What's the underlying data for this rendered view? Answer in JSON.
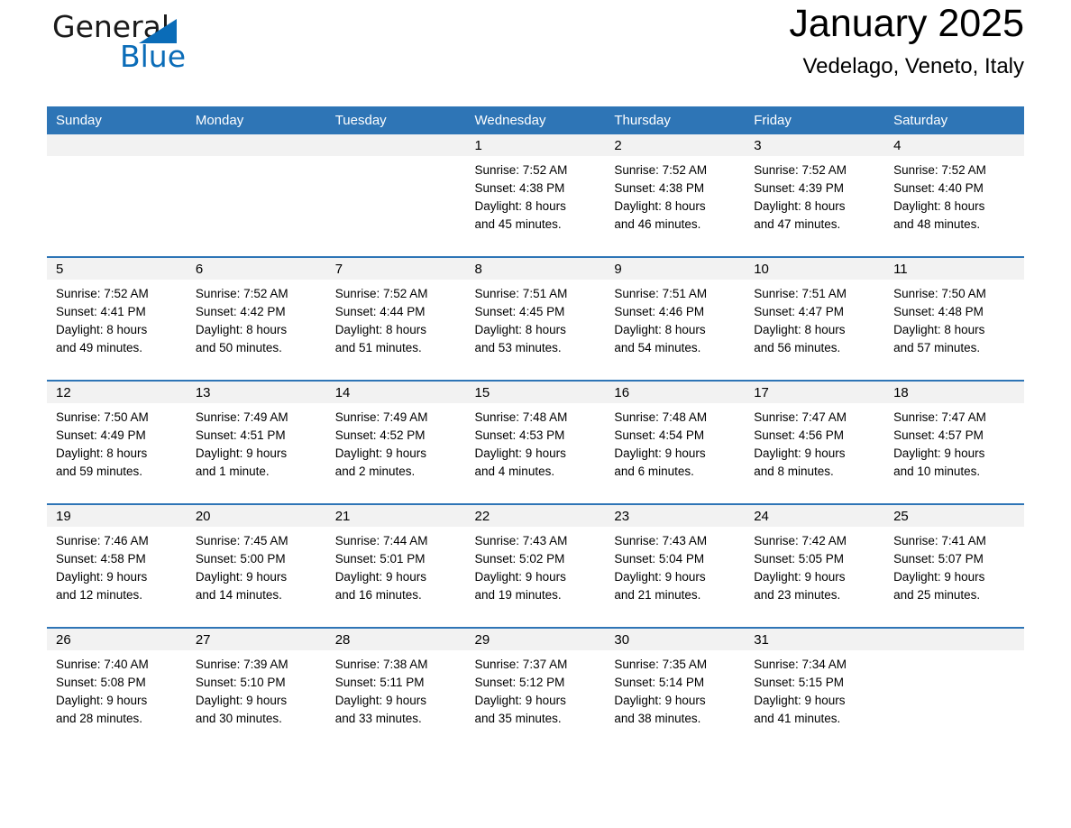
{
  "brand": {
    "name_part1": "General",
    "name_part2": "Blue",
    "triangle_color": "#0a6cb8"
  },
  "header": {
    "month_title": "January 2025",
    "location": "Vedelago, Veneto, Italy",
    "header_bg": "#2e75b6",
    "daynum_bg": "#f2f2f2"
  },
  "weekday_headers": [
    "Sunday",
    "Monday",
    "Tuesday",
    "Wednesday",
    "Thursday",
    "Friday",
    "Saturday"
  ],
  "labels": {
    "sunrise_prefix": "Sunrise:",
    "sunset_prefix": "Sunset:",
    "daylight_prefix": "Daylight:"
  },
  "weeks": [
    [
      {
        "day": "",
        "empty": true
      },
      {
        "day": "",
        "empty": true
      },
      {
        "day": "",
        "empty": true
      },
      {
        "day": "1",
        "sunrise": "Sunrise: 7:52 AM",
        "sunset": "Sunset: 4:38 PM",
        "daylight_line1": "Daylight: 8 hours",
        "daylight_line2": "and 45 minutes."
      },
      {
        "day": "2",
        "sunrise": "Sunrise: 7:52 AM",
        "sunset": "Sunset: 4:38 PM",
        "daylight_line1": "Daylight: 8 hours",
        "daylight_line2": "and 46 minutes."
      },
      {
        "day": "3",
        "sunrise": "Sunrise: 7:52 AM",
        "sunset": "Sunset: 4:39 PM",
        "daylight_line1": "Daylight: 8 hours",
        "daylight_line2": "and 47 minutes."
      },
      {
        "day": "4",
        "sunrise": "Sunrise: 7:52 AM",
        "sunset": "Sunset: 4:40 PM",
        "daylight_line1": "Daylight: 8 hours",
        "daylight_line2": "and 48 minutes."
      }
    ],
    [
      {
        "day": "5",
        "sunrise": "Sunrise: 7:52 AM",
        "sunset": "Sunset: 4:41 PM",
        "daylight_line1": "Daylight: 8 hours",
        "daylight_line2": "and 49 minutes."
      },
      {
        "day": "6",
        "sunrise": "Sunrise: 7:52 AM",
        "sunset": "Sunset: 4:42 PM",
        "daylight_line1": "Daylight: 8 hours",
        "daylight_line2": "and 50 minutes."
      },
      {
        "day": "7",
        "sunrise": "Sunrise: 7:52 AM",
        "sunset": "Sunset: 4:44 PM",
        "daylight_line1": "Daylight: 8 hours",
        "daylight_line2": "and 51 minutes."
      },
      {
        "day": "8",
        "sunrise": "Sunrise: 7:51 AM",
        "sunset": "Sunset: 4:45 PM",
        "daylight_line1": "Daylight: 8 hours",
        "daylight_line2": "and 53 minutes."
      },
      {
        "day": "9",
        "sunrise": "Sunrise: 7:51 AM",
        "sunset": "Sunset: 4:46 PM",
        "daylight_line1": "Daylight: 8 hours",
        "daylight_line2": "and 54 minutes."
      },
      {
        "day": "10",
        "sunrise": "Sunrise: 7:51 AM",
        "sunset": "Sunset: 4:47 PM",
        "daylight_line1": "Daylight: 8 hours",
        "daylight_line2": "and 56 minutes."
      },
      {
        "day": "11",
        "sunrise": "Sunrise: 7:50 AM",
        "sunset": "Sunset: 4:48 PM",
        "daylight_line1": "Daylight: 8 hours",
        "daylight_line2": "and 57 minutes."
      }
    ],
    [
      {
        "day": "12",
        "sunrise": "Sunrise: 7:50 AM",
        "sunset": "Sunset: 4:49 PM",
        "daylight_line1": "Daylight: 8 hours",
        "daylight_line2": "and 59 minutes."
      },
      {
        "day": "13",
        "sunrise": "Sunrise: 7:49 AM",
        "sunset": "Sunset: 4:51 PM",
        "daylight_line1": "Daylight: 9 hours",
        "daylight_line2": "and 1 minute."
      },
      {
        "day": "14",
        "sunrise": "Sunrise: 7:49 AM",
        "sunset": "Sunset: 4:52 PM",
        "daylight_line1": "Daylight: 9 hours",
        "daylight_line2": "and 2 minutes."
      },
      {
        "day": "15",
        "sunrise": "Sunrise: 7:48 AM",
        "sunset": "Sunset: 4:53 PM",
        "daylight_line1": "Daylight: 9 hours",
        "daylight_line2": "and 4 minutes."
      },
      {
        "day": "16",
        "sunrise": "Sunrise: 7:48 AM",
        "sunset": "Sunset: 4:54 PM",
        "daylight_line1": "Daylight: 9 hours",
        "daylight_line2": "and 6 minutes."
      },
      {
        "day": "17",
        "sunrise": "Sunrise: 7:47 AM",
        "sunset": "Sunset: 4:56 PM",
        "daylight_line1": "Daylight: 9 hours",
        "daylight_line2": "and 8 minutes."
      },
      {
        "day": "18",
        "sunrise": "Sunrise: 7:47 AM",
        "sunset": "Sunset: 4:57 PM",
        "daylight_line1": "Daylight: 9 hours",
        "daylight_line2": "and 10 minutes."
      }
    ],
    [
      {
        "day": "19",
        "sunrise": "Sunrise: 7:46 AM",
        "sunset": "Sunset: 4:58 PM",
        "daylight_line1": "Daylight: 9 hours",
        "daylight_line2": "and 12 minutes."
      },
      {
        "day": "20",
        "sunrise": "Sunrise: 7:45 AM",
        "sunset": "Sunset: 5:00 PM",
        "daylight_line1": "Daylight: 9 hours",
        "daylight_line2": "and 14 minutes."
      },
      {
        "day": "21",
        "sunrise": "Sunrise: 7:44 AM",
        "sunset": "Sunset: 5:01 PM",
        "daylight_line1": "Daylight: 9 hours",
        "daylight_line2": "and 16 minutes."
      },
      {
        "day": "22",
        "sunrise": "Sunrise: 7:43 AM",
        "sunset": "Sunset: 5:02 PM",
        "daylight_line1": "Daylight: 9 hours",
        "daylight_line2": "and 19 minutes."
      },
      {
        "day": "23",
        "sunrise": "Sunrise: 7:43 AM",
        "sunset": "Sunset: 5:04 PM",
        "daylight_line1": "Daylight: 9 hours",
        "daylight_line2": "and 21 minutes."
      },
      {
        "day": "24",
        "sunrise": "Sunrise: 7:42 AM",
        "sunset": "Sunset: 5:05 PM",
        "daylight_line1": "Daylight: 9 hours",
        "daylight_line2": "and 23 minutes."
      },
      {
        "day": "25",
        "sunrise": "Sunrise: 7:41 AM",
        "sunset": "Sunset: 5:07 PM",
        "daylight_line1": "Daylight: 9 hours",
        "daylight_line2": "and 25 minutes."
      }
    ],
    [
      {
        "day": "26",
        "sunrise": "Sunrise: 7:40 AM",
        "sunset": "Sunset: 5:08 PM",
        "daylight_line1": "Daylight: 9 hours",
        "daylight_line2": "and 28 minutes."
      },
      {
        "day": "27",
        "sunrise": "Sunrise: 7:39 AM",
        "sunset": "Sunset: 5:10 PM",
        "daylight_line1": "Daylight: 9 hours",
        "daylight_line2": "and 30 minutes."
      },
      {
        "day": "28",
        "sunrise": "Sunrise: 7:38 AM",
        "sunset": "Sunset: 5:11 PM",
        "daylight_line1": "Daylight: 9 hours",
        "daylight_line2": "and 33 minutes."
      },
      {
        "day": "29",
        "sunrise": "Sunrise: 7:37 AM",
        "sunset": "Sunset: 5:12 PM",
        "daylight_line1": "Daylight: 9 hours",
        "daylight_line2": "and 35 minutes."
      },
      {
        "day": "30",
        "sunrise": "Sunrise: 7:35 AM",
        "sunset": "Sunset: 5:14 PM",
        "daylight_line1": "Daylight: 9 hours",
        "daylight_line2": "and 38 minutes."
      },
      {
        "day": "31",
        "sunrise": "Sunrise: 7:34 AM",
        "sunset": "Sunset: 5:15 PM",
        "daylight_line1": "Daylight: 9 hours",
        "daylight_line2": "and 41 minutes."
      },
      {
        "day": "",
        "empty": true
      }
    ]
  ]
}
